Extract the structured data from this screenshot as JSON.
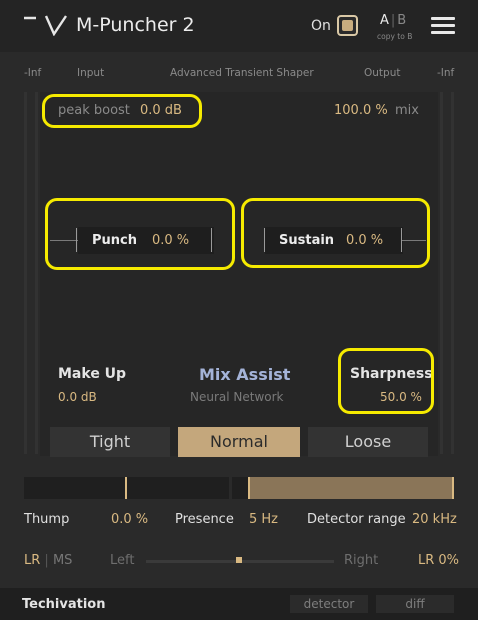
{
  "header": {
    "title": "M-Puncher 2",
    "on_label": "On",
    "on_state": true,
    "ab_a": "A",
    "ab_sep": "|",
    "ab_b": "B",
    "copy_label": "copy to B"
  },
  "labels": {
    "inf_left": "-Inf",
    "input": "Input",
    "subtitle": "Advanced Transient Shaper",
    "output": "Output",
    "inf_right": "-Inf"
  },
  "peak_boost": {
    "label": "peak boost",
    "value": "0.0 dB"
  },
  "mix": {
    "value": "100.0 %",
    "label": "mix"
  },
  "punch": {
    "label": "Punch",
    "value": "0.0 %"
  },
  "sustain": {
    "label": "Sustain",
    "value": "0.0 %"
  },
  "makeup": {
    "label": "Make Up",
    "value": "0.0 dB"
  },
  "mix_assist": {
    "label": "Mix Assist",
    "sub": "Neural Network"
  },
  "sharpness": {
    "label": "Sharpness",
    "value": "50.0 %"
  },
  "modes": {
    "tight": "Tight",
    "normal": "Normal",
    "loose": "Loose",
    "selected": "Normal"
  },
  "thump": {
    "label": "Thump",
    "value": "0.0 %",
    "level": 0.5
  },
  "presence": {
    "label": "Presence",
    "value": "5 Hz"
  },
  "detector_range": {
    "label": "Detector range",
    "value": "20 kHz",
    "level": 1.0
  },
  "stereo": {
    "lr": "LR",
    "sep": "|",
    "ms": "MS",
    "left": "Left",
    "right": "Right",
    "value": "LR 0%",
    "balance": 0.5
  },
  "footer": {
    "brand": "Techivation",
    "detector": "detector",
    "diff": "diff"
  },
  "colors": {
    "accent": "#d9b982",
    "highlight": "#f5ea00",
    "mix_assist": "#a4b3d8"
  }
}
